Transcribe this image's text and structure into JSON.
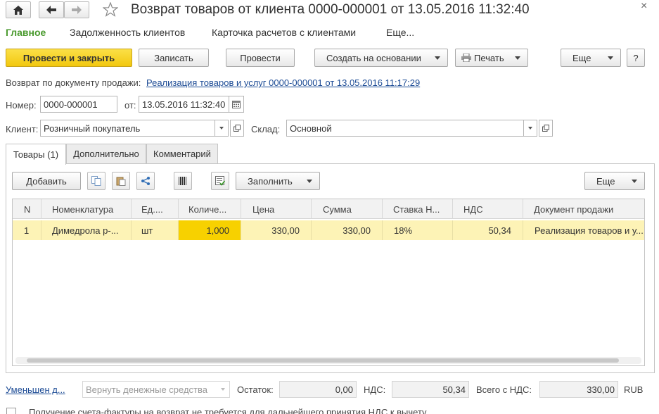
{
  "window": {
    "title": "Возврат товаров от клиента 0000-000001 от 13.05.2016 11:32:40"
  },
  "nav": {
    "items": [
      "Главное",
      "Задолженность клиентов",
      "Карточка расчетов с клиентами",
      "Еще..."
    ]
  },
  "toolbar": {
    "post_close": "Провести и закрыть",
    "save": "Записать",
    "post": "Провести",
    "create_based": "Создать на основании",
    "print": "Печать",
    "more": "Еще",
    "help": "?"
  },
  "header": {
    "sale_doc_label": "Возврат по документу продажи:",
    "sale_doc_link": "Реализация товаров и услуг 0000-000001 от 13.05.2016 11:17:29",
    "number_label": "Номер:",
    "number_value": "0000-000001",
    "date_label": "от:",
    "date_value": "13.05.2016 11:32:40",
    "client_label": "Клиент:",
    "client_value": "Розничный покупатель",
    "warehouse_label": "Склад:",
    "warehouse_value": "Основной"
  },
  "tabs": [
    {
      "label": "Товары (1)",
      "active": true
    },
    {
      "label": "Дополнительно",
      "active": false
    },
    {
      "label": "Комментарий",
      "active": false
    }
  ],
  "goods_toolbar": {
    "add": "Добавить",
    "fill": "Заполнить",
    "more": "Еще"
  },
  "table": {
    "columns": [
      "N",
      "Номенклатура",
      "Ед....",
      "Количе...",
      "Цена",
      "Сумма",
      "Ставка Н...",
      "НДС",
      "Документ продажи"
    ],
    "rows": [
      [
        "1",
        "Димедрола р-...",
        "шт",
        "1,000",
        "330,00",
        "330,00",
        "18%",
        "50,34",
        "Реализация товаров и у..."
      ]
    ]
  },
  "footer": {
    "reduced_link": "Уменьшен д...",
    "refund_placeholder": "Вернуть денежные средства",
    "balance_label": "Остаток:",
    "balance_value": "0,00",
    "vat_label": "НДС:",
    "vat_value": "50,34",
    "total_label": "Всего с НДС:",
    "total_value": "330,00",
    "currency": "RUB",
    "invoice_note": "Получение счета-фактуры на возврат не требуется для дальнейшего принятия НДС к вычету"
  },
  "colors": {
    "accent_yellow": "#f7d21e",
    "nav_active_green": "#4a9a2e",
    "row_highlight": "#fdf3b6",
    "link_blue": "#1c4b95"
  }
}
